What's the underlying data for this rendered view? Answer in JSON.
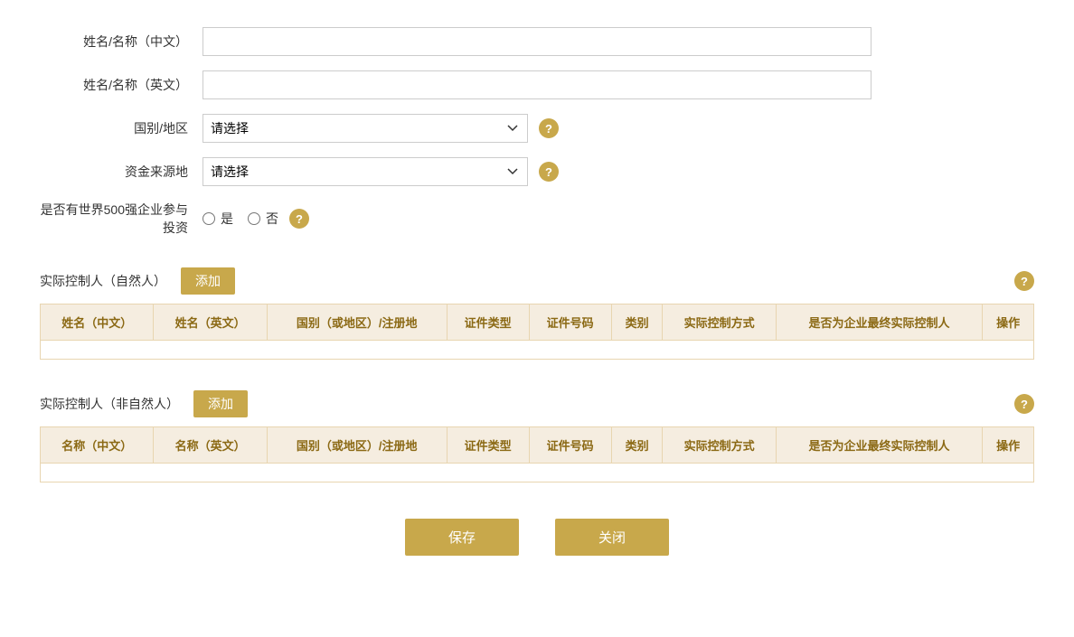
{
  "form": {
    "name_cn_label": "姓名/名称（中文）",
    "name_en_label": "姓名/名称（英文）",
    "country_label": "国别/地区",
    "fund_source_label": "资金来源地",
    "fortune500_label": "是否有世界500强企业参与投资",
    "fortune500_yes": "是",
    "fortune500_no": "否",
    "select_placeholder": "请选择",
    "name_cn_placeholder": "",
    "name_en_placeholder": ""
  },
  "natural_controller": {
    "title": "实际控制人（自然人）",
    "add_label": "添加",
    "help_icon": "?",
    "columns": [
      "姓名（中文）",
      "姓名（英文）",
      "国别（或地区）/注册地",
      "证件类型",
      "证件号码",
      "类别",
      "实际控制方式",
      "是否为企业最终实际控制人",
      "操作"
    ]
  },
  "non_natural_controller": {
    "title": "实际控制人（非自然人）",
    "add_label": "添加",
    "help_icon": "?",
    "columns": [
      "名称（中文）",
      "名称（英文）",
      "国别（或地区）/注册地",
      "证件类型",
      "证件号码",
      "类别",
      "实际控制方式",
      "是否为企业最终实际控制人",
      "操作"
    ]
  },
  "buttons": {
    "save": "保存",
    "close": "关闭"
  },
  "help_icon_char": "?"
}
